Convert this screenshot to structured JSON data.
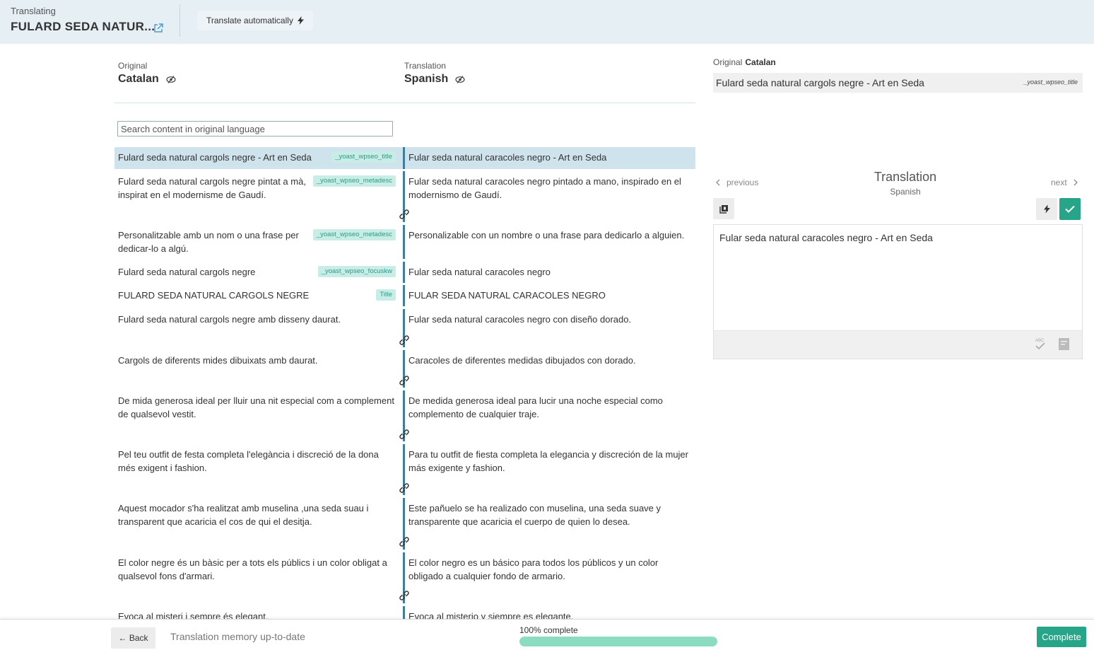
{
  "header": {
    "label": "Translating",
    "title": "FULARD SEDA NATUR...",
    "auto_translate_label": "Translate automatically"
  },
  "columns": {
    "original": {
      "caption": "Original",
      "language": "Catalan"
    },
    "translation": {
      "caption": "Translation",
      "language": "Spanish"
    }
  },
  "search": {
    "placeholder": "Search content in original language",
    "value": ""
  },
  "segments": [
    {
      "original": "Fulard seda natural cargols negre - Art en Seda",
      "tag": "_yoast_wpseo_title",
      "translation": "Fular seda natural caracoles negro - Art en Seda",
      "active": true
    },
    {
      "original": "Fulard seda natural cargols negre pintat a mà, inspirat en el modernisme de Gaudí.",
      "tag": "_yoast_wpseo_metadesc",
      "translation": "Fular seda natural caracoles negro pintado a mano, inspirado en el modernismo de Gaudí."
    },
    {
      "original": "Personalitzable amb un nom o una frase per dedicar-lo a algú.",
      "tag": "_yoast_wpseo_metadesc",
      "translation": "Personalizable con un nombre o una frase para dedicarlo a alguien."
    },
    {
      "original": "Fulard seda natural cargols negre",
      "tag": "_yoast_wpseo_focuskw",
      "translation": "Fular seda natural caracoles negro"
    },
    {
      "original": "FULARD SEDA NATURAL CARGOLS NEGRE",
      "tag": "Title",
      "translation": "FULAR SEDA NATURAL CARACOLES NEGRO"
    },
    {
      "original": "Fulard seda natural cargols negre amb disseny daurat.",
      "tag": "",
      "translation": "Fular seda natural caracoles negro con diseño dorado."
    },
    {
      "original": "Cargols de diferents mides dibuixats amb daurat.",
      "tag": "",
      "translation": "Caracoles de diferentes medidas dibujados con dorado."
    },
    {
      "original": "De mida generosa ideal per lluir una nit especial com a complement de qualsevol vestit.",
      "tag": "",
      "translation": "De medida generosa ideal para lucir una noche especial como complemento de cualquier traje."
    },
    {
      "original": "Pel teu outfit de festa completa l'elegància i discreció de la dona més exigent i fashion.",
      "tag": "",
      "translation": "Para tu outfit de fiesta completa la elegancia y discreción de la mujer más exigente y fashion."
    },
    {
      "original": "Aquest mocador s'ha realitzat amb muselina ,una seda suau i transparent que acaricia el cos de qui el desitja.",
      "tag": "",
      "translation": "Este pañuelo se ha realizado con muselina, una seda suave y transparente que acaricia el cuerpo de quien lo desea."
    },
    {
      "original": "El color negre és un bàsic per a tots els públics i un color obligat a qualsevol fons d'armari.",
      "tag": "",
      "translation": "El color negro es un básico para todos los públicos y un color obligado a cualquier fondo de armario."
    },
    {
      "original": "Evoca al misteri i sempre és elegant.",
      "tag": "",
      "translation": "Evoca al misterio y siempre es elegante."
    }
  ],
  "right_panel": {
    "original_caption": "Original",
    "original_language": "Catalan",
    "original_text": "Fulard seda natural cargols negre - Art en Seda",
    "field_name": "_yoast_wpseo_title",
    "previous_label": "previous",
    "next_label": "next",
    "title": "Translation",
    "language": "Spanish",
    "translation_text": "Fular seda natural caracoles negro - Art en Seda"
  },
  "footer": {
    "back_label": "← Back",
    "tm_status": "Translation memory up-to-date",
    "progress_label": "100% complete",
    "progress": 1.0,
    "complete_label": "Complete"
  },
  "colors": {
    "header_bg": "#e5eff4",
    "accent": "#27a589",
    "segment_divider": "#3f7d9b",
    "active_row": "#cfe3ec",
    "tag_bg": "#c8ece6",
    "tag_text": "#2e9b85"
  },
  "icons": {
    "external": "external-link-icon",
    "bolt": "bolt-icon",
    "visibility": "eye-slash-icon",
    "link": "link-icon",
    "copy": "copy-icon",
    "check": "check-icon",
    "spellcheck": "spellcheck-icon",
    "glossary": "glossary-icon"
  }
}
